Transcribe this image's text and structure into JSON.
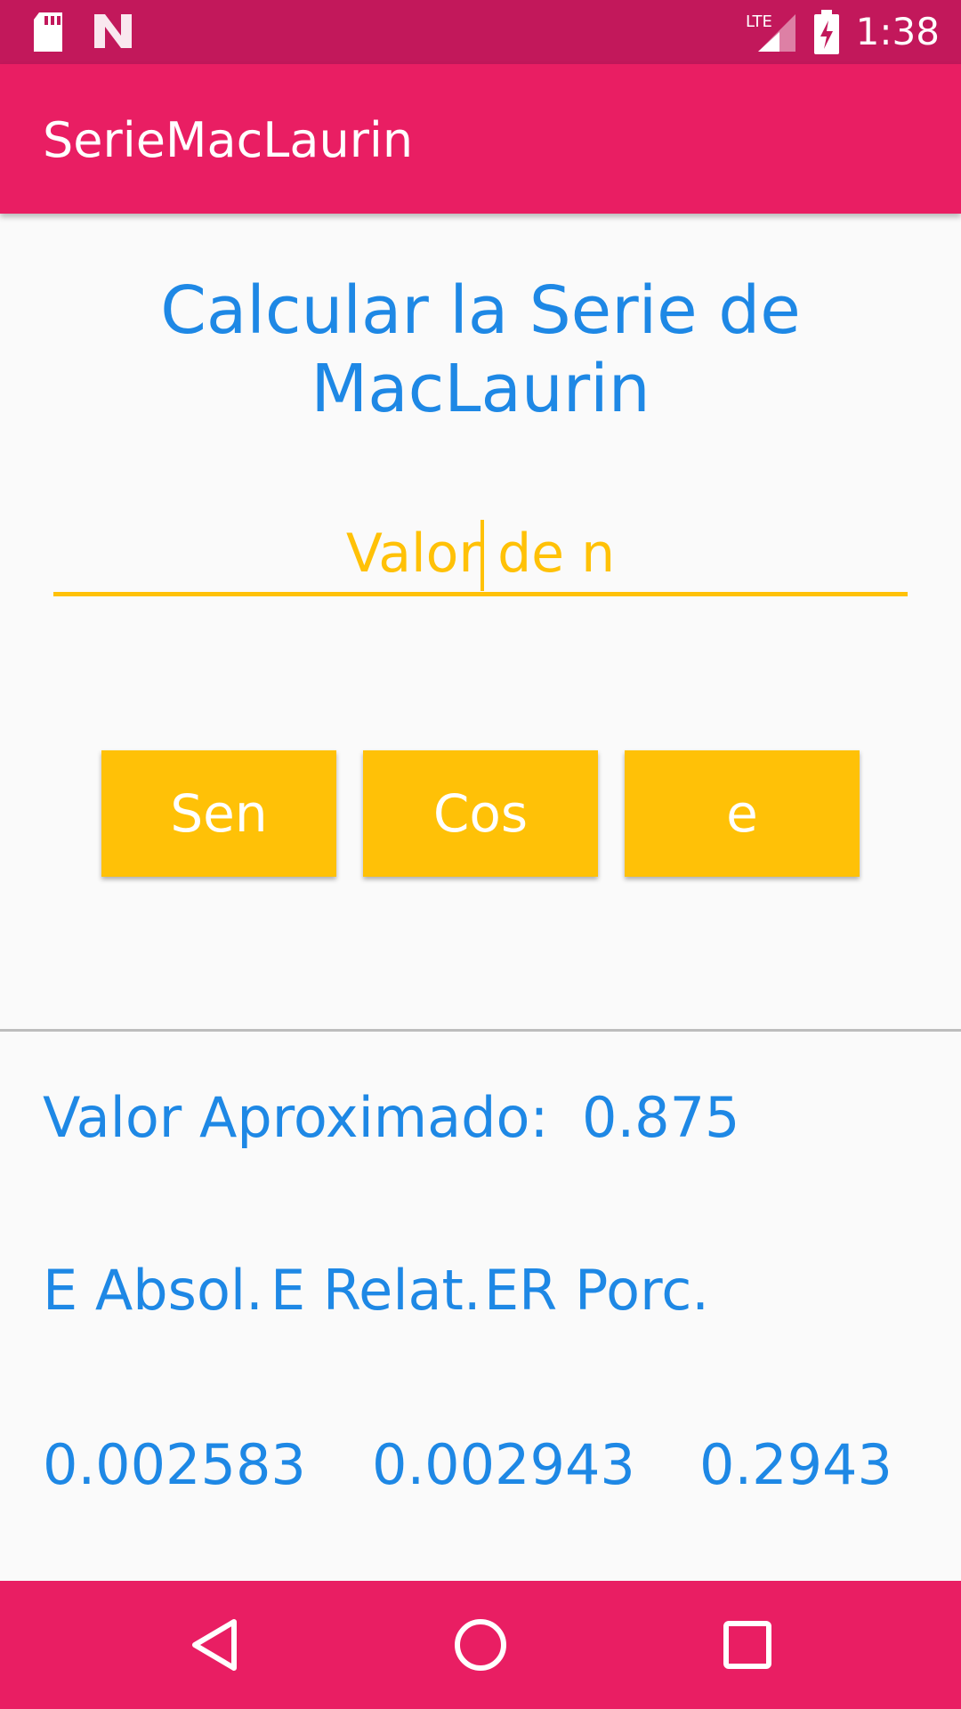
{
  "status_bar": {
    "time": "1:38",
    "network": "LTE",
    "icons": [
      "sd-card-icon",
      "n-logo-icon",
      "lte-signal-icon",
      "battery-charging-icon"
    ]
  },
  "app_bar": {
    "title": "SerieMacLaurin"
  },
  "main": {
    "heading_line1": "Calcular la Serie de",
    "heading_line2": "MacLaurin",
    "input": {
      "placeholder": "Valor de n",
      "value": ""
    },
    "buttons": {
      "sen": "Sen",
      "cos": "Cos",
      "e": "e"
    }
  },
  "results": {
    "approx_label": "Valor Aproximado:",
    "approx_value": "0.875",
    "headers": [
      "E Absol.",
      "E Relat.",
      "ER Porc."
    ],
    "values": [
      "0.002583",
      "0.002943",
      "0.2943"
    ]
  },
  "colors": {
    "status_bar": "#C2185B",
    "primary": "#E91E63",
    "accent": "#FFC107",
    "text_blue": "#1E88E5"
  },
  "nav_bar": {
    "icons": [
      "back-icon",
      "home-icon",
      "recents-icon"
    ]
  }
}
